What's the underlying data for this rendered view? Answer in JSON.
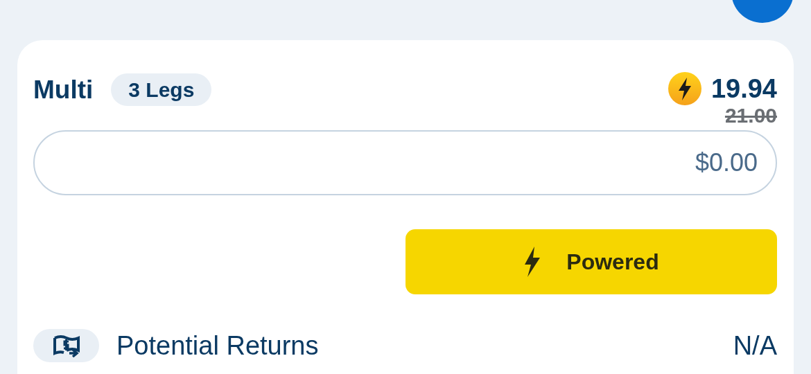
{
  "bet": {
    "title": "Multi",
    "legs_badge": "3 Legs",
    "boosted_odds": "19.94",
    "original_odds": "21.00"
  },
  "stake_field": {
    "value": "$0.00"
  },
  "powered_button": {
    "label": "Powered"
  },
  "returns": {
    "label": "Potential Returns",
    "value": "N/A"
  }
}
